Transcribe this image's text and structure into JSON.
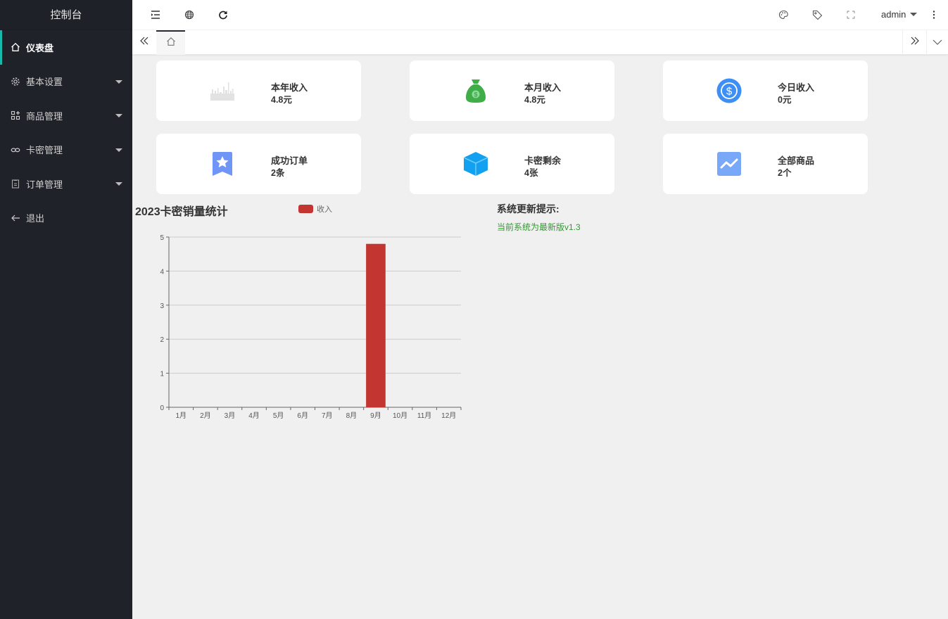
{
  "sidebar": {
    "title": "控制台",
    "items": [
      {
        "label": "仪表盘",
        "icon": "home-icon",
        "active": true,
        "expandable": false
      },
      {
        "label": "基本设置",
        "icon": "gear-icon",
        "active": false,
        "expandable": true
      },
      {
        "label": "商品管理",
        "icon": "apps-icon",
        "active": false,
        "expandable": true
      },
      {
        "label": "卡密管理",
        "icon": "link-icon",
        "active": false,
        "expandable": true
      },
      {
        "label": "订单管理",
        "icon": "clipboard-icon",
        "active": false,
        "expandable": true
      },
      {
        "label": "退出",
        "icon": "arrow-left-icon",
        "active": false,
        "expandable": false
      }
    ]
  },
  "header": {
    "left_icons": [
      "menu-fold-icon",
      "globe-icon",
      "refresh-icon"
    ],
    "right_icons": [
      "theme-palette-icon",
      "tag-icon",
      "fullscreen-icon"
    ],
    "user": "admin",
    "more_icon": "more-vertical-icon"
  },
  "tabs": {
    "prev_icon": "double-left-icon",
    "home_icon": "home-icon",
    "next_icon": "double-right-icon",
    "more_icon": "chevron-down-icon"
  },
  "stats": [
    {
      "label": "本年收入",
      "value": "4.8元",
      "icon": "city-skyline-icon"
    },
    {
      "label": "本月收入",
      "value": "4.8元",
      "icon": "money-bag-icon"
    },
    {
      "label": "今日收入",
      "value": "0元",
      "icon": "dollar-coin-icon"
    },
    {
      "label": "成功订单",
      "value": "2条",
      "icon": "star-bookmark-icon"
    },
    {
      "label": "卡密剩余",
      "value": "4张",
      "icon": "cube-icon"
    },
    {
      "label": "全部商品",
      "value": "2个",
      "icon": "trend-chart-icon"
    }
  ],
  "colors": {
    "sidebar_bg": "#20222a",
    "active_accent": "#16baaa",
    "bar": "#c23531",
    "update_text": "#2e9b2e"
  },
  "update": {
    "title": "系统更新提示:",
    "text": "当前系统为最新版v1.3"
  },
  "chart_data": {
    "type": "bar",
    "title": "2023卡密销量统计",
    "legend": [
      "收入"
    ],
    "legend_position": "top-center",
    "categories": [
      "1月",
      "2月",
      "3月",
      "4月",
      "5月",
      "6月",
      "7月",
      "8月",
      "9月",
      "10月",
      "11月",
      "12月"
    ],
    "series": [
      {
        "name": "收入",
        "values": [
          0,
          0,
          0,
          0,
          0,
          0,
          0,
          0,
          4.8,
          0,
          0,
          0
        ]
      }
    ],
    "yticks": [
      0,
      1,
      2,
      3,
      4,
      5
    ],
    "ylim": [
      0,
      5
    ],
    "xlabel": "",
    "ylabel": "",
    "grid": true
  }
}
